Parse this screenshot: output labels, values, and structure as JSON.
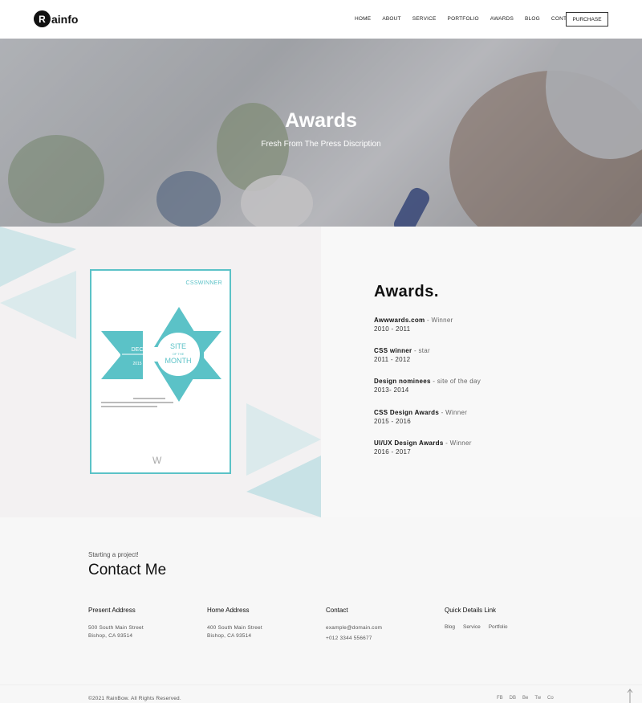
{
  "header": {
    "logo_letter": "R",
    "logo_text": "ainfo",
    "nav": [
      "HOME",
      "ABOUT",
      "SERVICE",
      "PORTFOLIO",
      "AWARDS",
      "BLOG",
      "CONTACT"
    ],
    "purchase_label": "PURCHASE"
  },
  "hero": {
    "title": "Awards",
    "subtitle": "Fresh From The Press Discription"
  },
  "certificate": {
    "brand": "CSSWINNER",
    "center_top": "SITE",
    "center_mid": "OF THE",
    "center_bottom": "MONTH",
    "left_top": "DEC",
    "left_bottom": "2015",
    "accent_color": "#5bc2c7"
  },
  "awards": {
    "heading": "Awards.",
    "items": [
      {
        "name": "Awwwards.com",
        "role": " - Winner",
        "years": "2010 - 2011"
      },
      {
        "name": "CSS winner",
        "role": " - star",
        "years": "2011 - 2012"
      },
      {
        "name": "Design nominees",
        "role": " - site of the day",
        "years": "2013- 2014"
      },
      {
        "name": "CSS Design Awards",
        "role": " - Winner",
        "years": "2015 - 2016"
      },
      {
        "name": "UI/UX Design Awards",
        "role": " - Winner",
        "years": "2016 - 2017"
      }
    ]
  },
  "contact": {
    "kicker": "Starting a project!",
    "title": "Contact Me",
    "present": {
      "title": "Present Address",
      "line1": "500 South Main Street",
      "line2": "Bishop, CA 93514"
    },
    "home": {
      "title": "Home Address",
      "line1": "400 South Main Street",
      "line2": "Bishop, CA 93514"
    },
    "contact": {
      "title": "Contact",
      "email": "example@domain.com",
      "phone": "+012 3344 556677"
    },
    "quick": {
      "title": "Quick Details Link",
      "links": [
        "Blog",
        "Service",
        "Portfolio"
      ]
    }
  },
  "footer": {
    "copyright": "©2021 RainBow. All Rights Reserved.",
    "socials": [
      "FB",
      "DB",
      "Be",
      "Tw",
      "Co"
    ]
  }
}
